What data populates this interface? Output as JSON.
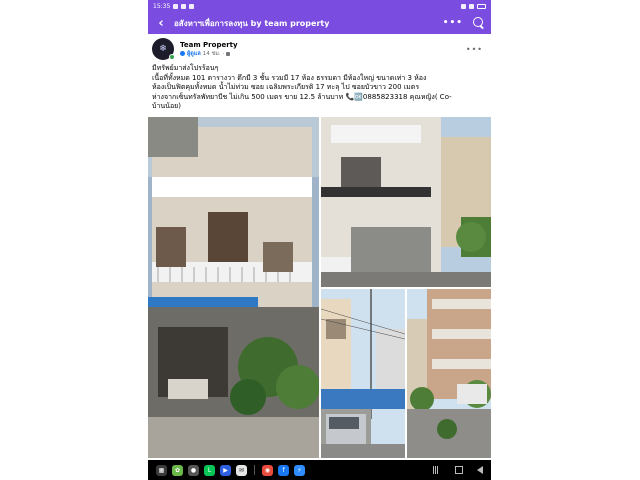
{
  "status_bar": {
    "time": "15:35"
  },
  "app_bar": {
    "title": "อสังหาฯเพื่อการลงทุน  by team property",
    "more": "•••"
  },
  "post": {
    "author": "Team Property",
    "role": "ผู้ดูแล",
    "time": "14 ชม.",
    "more": "•••",
    "lines": [
      "มีทรัพย์มาส่งโปรร้อนๆ",
      "เนื้อที่ทั้งหมด 101 ตารางวา ตึกมี 3 ชั้น รวมมี 17 ห้อง ธรรมดา มีห้องใหญ่ ขนาดเท่า 3 ห้อง",
      "ห้องเป็นฟิตคุมทั้งหมด  น้ำไม่ท่วม ซอย เฉลิมพระเกียรติ 17 ทะลุ ไป ซอยบัวขาว 200 เมตร",
      "ห่างจากเซ็นทรัลพัทยาบีช ไม่เกิน 500 เมตร ขาย 12.5 ล้านบาท 📞🆗0885823318 คุณหญิง( Co-",
      "บ้านน้อย)"
    ]
  },
  "photos": [
    {
      "name": "main-photo",
      "alt": "building-front"
    },
    {
      "name": "top-right-photo",
      "alt": "building-side"
    },
    {
      "name": "bottom-right-photo-1",
      "alt": "street-view"
    },
    {
      "name": "bottom-right-photo-2",
      "alt": "alley-view"
    }
  ],
  "taskbar_apps": [
    "grid-icon",
    "gallery-icon",
    "camera-icon",
    "line-icon",
    "files-icon",
    "chat-icon",
    "chrome-icon",
    "facebook-icon",
    "messenger-icon"
  ],
  "colors": {
    "brand": "#7b4ce0",
    "link": "#1877f2"
  }
}
